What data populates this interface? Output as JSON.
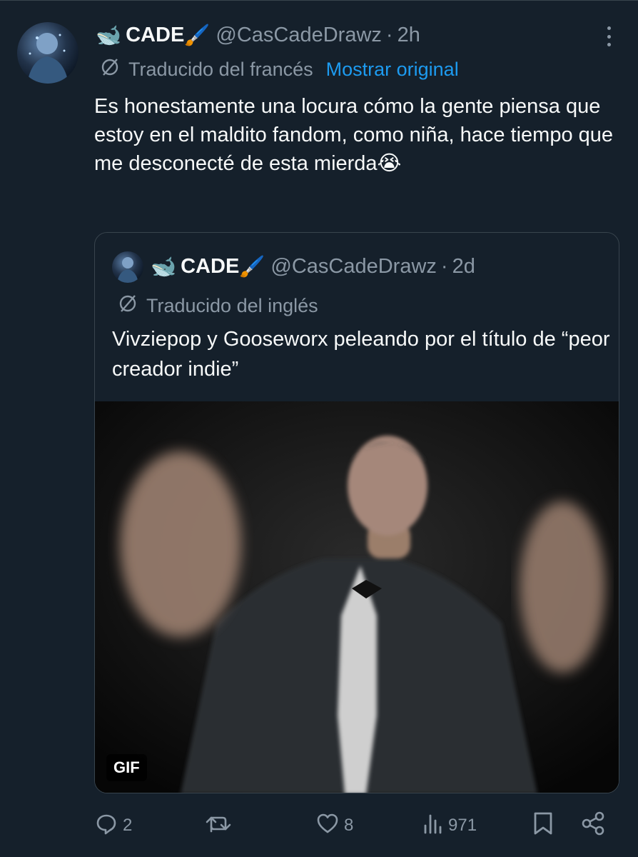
{
  "tweet": {
    "author": {
      "emoji_prefix": "🐋",
      "name": "CADE",
      "emoji_suffix": "🖌️",
      "handle": "@CasCadeDrawz",
      "separator": "·",
      "time": "2h"
    },
    "translation": {
      "label": "Traducido del francés",
      "show_original": "Mostrar original"
    },
    "text": "Es honestamente una locura cómo la gente piensa que estoy en el maldito fandom, como niña, hace tiempo que me desconecté de esta mierda😭"
  },
  "quote": {
    "author": {
      "emoji_prefix": "🐋",
      "name": "CADE",
      "emoji_suffix": "🖌️",
      "handle": "@CasCadeDrawz",
      "separator": "·",
      "time": "2d"
    },
    "translation": {
      "label": "Traducido del inglés"
    },
    "text": "Vivziepop y Gooseworx peleando por el título de “peor creador indie”",
    "media": {
      "badge": "GIF"
    }
  },
  "actions": {
    "replies": "2",
    "reposts": "",
    "likes": "8",
    "views": "971"
  },
  "colors": {
    "background": "#15202b",
    "text": "#f7f9f9",
    "muted": "#8b98a5",
    "accent": "#1d9bf0",
    "border": "#38444d"
  },
  "icons": [
    "translate-icon",
    "more-icon",
    "reply-icon",
    "repost-icon",
    "like-icon",
    "views-icon",
    "bookmark-icon",
    "share-icon"
  ]
}
